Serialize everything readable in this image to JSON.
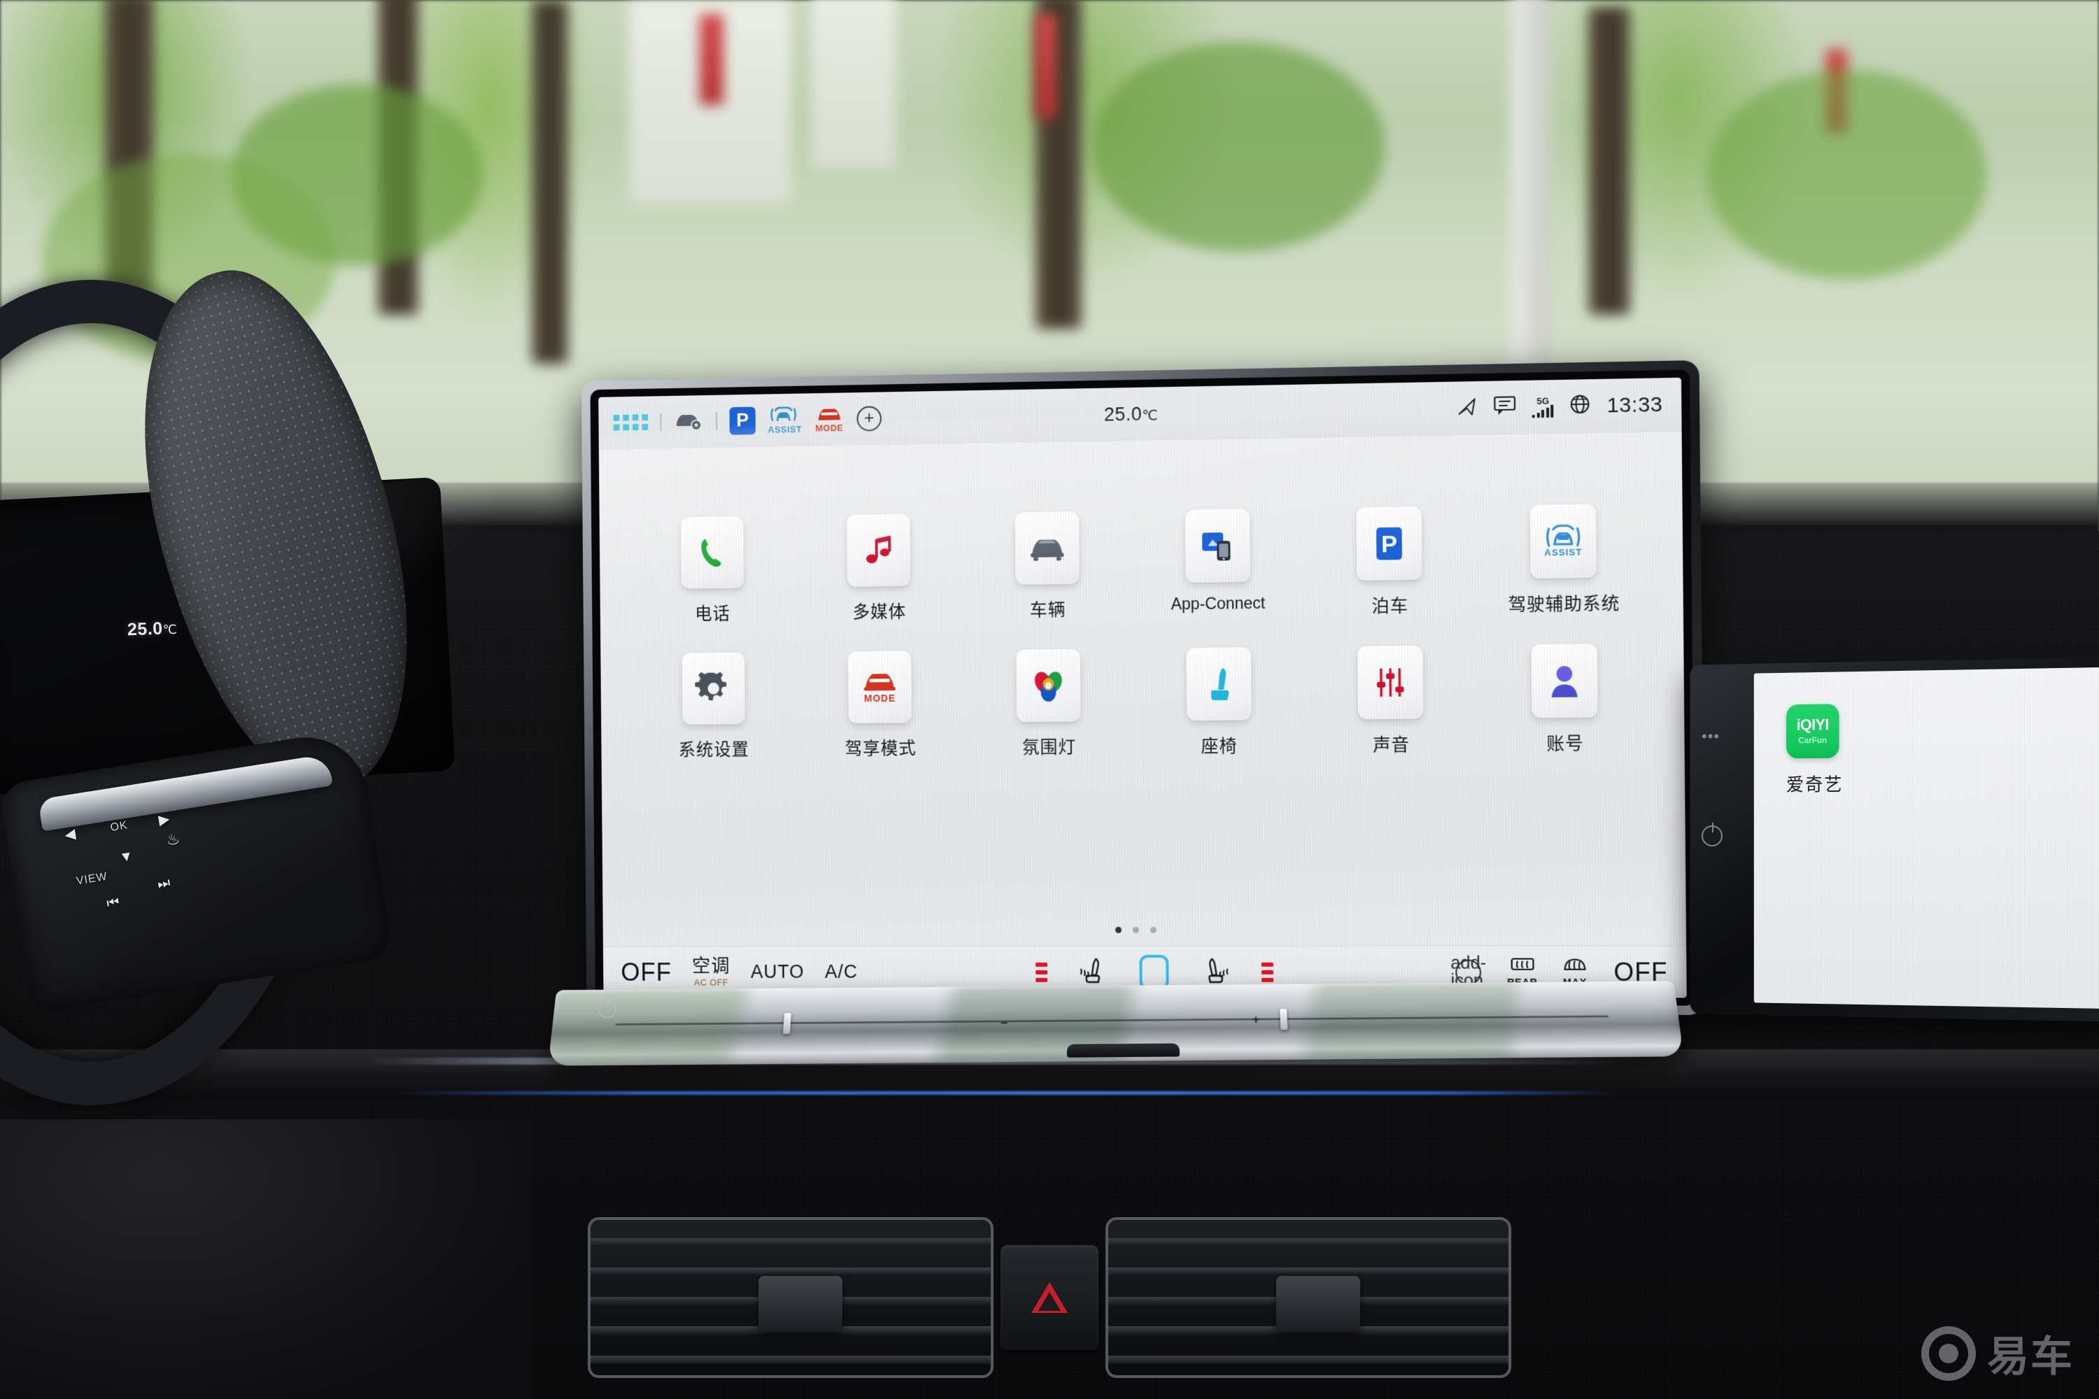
{
  "scene": {
    "description": "car-interior-dashboard",
    "watermark": {
      "text": "易车",
      "icon": "yiche-logo-icon"
    }
  },
  "cluster": {
    "temperature": "25.0",
    "unit": "℃"
  },
  "steering_wheel": {
    "buttons": [
      {
        "name": "view-button",
        "label": "VIEW"
      },
      {
        "name": "ok-button",
        "label": "OK"
      },
      {
        "name": "left-arrow-button",
        "label": "◀"
      },
      {
        "name": "right-arrow-button",
        "label": "▶"
      },
      {
        "name": "down-arrow-button",
        "label": "▼"
      },
      {
        "name": "previous-track-button",
        "label": "⏮"
      },
      {
        "name": "next-track-button",
        "label": "⏭"
      },
      {
        "name": "heated-wheel-button",
        "label": "♨"
      }
    ]
  },
  "head_unit": {
    "status_bar": {
      "left_icons": [
        {
          "name": "app-grid-icon",
          "label": "apps"
        },
        {
          "name": "vehicle-settings-icon",
          "label": "car-gear"
        },
        {
          "name": "parking-brake-icon",
          "label": "P"
        },
        {
          "name": "driver-assist-icon",
          "label": "ASSIST"
        },
        {
          "name": "drive-mode-icon",
          "label": "MODE"
        },
        {
          "name": "add-shortcut-icon",
          "label": "+"
        }
      ],
      "temperature": "25.0",
      "temperature_unit": "℃",
      "right_icons": [
        {
          "name": "navigation-arrow-icon",
          "label": "navigation"
        },
        {
          "name": "message-icon",
          "label": "messages"
        },
        {
          "name": "network-signal-icon",
          "label": "5G"
        },
        {
          "name": "globe-icon",
          "label": "browser"
        }
      ],
      "time": "13:33"
    },
    "apps": [
      {
        "label": "电话",
        "icon": "phone-icon",
        "color": "#1aa832"
      },
      {
        "label": "多媒体",
        "icon": "music-note-icon",
        "color": "#cc1230"
      },
      {
        "label": "车辆",
        "icon": "car-front-icon",
        "color": "#5a6470"
      },
      {
        "label": "App-Connect",
        "icon": "app-connect-icon",
        "color": "#1d62d8"
      },
      {
        "label": "泊车",
        "icon": "parking-p-icon",
        "color": "#1d62d8"
      },
      {
        "label": "驾驶辅助系统",
        "icon": "assist-car-icon",
        "color": "#2f8fd8"
      },
      {
        "label": "系统设置",
        "icon": "gear-icon",
        "color": "#4a525c"
      },
      {
        "label": "驾享模式",
        "icon": "drive-mode-icon",
        "color": "#d6341f"
      },
      {
        "label": "氛围灯",
        "icon": "ambient-light-icon",
        "color": "#2c8a4b"
      },
      {
        "label": "座椅",
        "icon": "seat-icon",
        "color": "#22b6d8"
      },
      {
        "label": "声音",
        "icon": "sound-mixer-icon",
        "color": "#cc1230"
      },
      {
        "label": "账号",
        "icon": "user-account-icon",
        "color": "#4b4fd0"
      }
    ],
    "pager": {
      "total": 3,
      "active": 1
    },
    "climate_bar": {
      "left_off": "OFF",
      "ac_label": "空调",
      "ac_sub": "AC OFF",
      "auto": "AUTO",
      "ac": "A/C",
      "driver_seat_icon": "seat-heat-driver-icon",
      "passenger_seat_icon": "seat-heat-passenger-icon",
      "center_toggle_icon": "climate-sync-icon",
      "plus_icon": "add-icon",
      "rear_defrost": "REAR",
      "max_defrost": "MAX",
      "right_off": "OFF"
    },
    "lower_strip": {
      "minus": "−",
      "plus": "+"
    }
  },
  "passenger_display": {
    "app": {
      "label": "爱奇艺",
      "wordmark": "iQIYI",
      "subbrand": "CarFun",
      "icon": "iqiyi-icon"
    },
    "buttons": [
      {
        "name": "brightness-button",
        "label": "•••"
      },
      {
        "name": "power-button",
        "label": "power"
      }
    ]
  },
  "colors": {
    "accent_blue": "#1d62d8",
    "assist_blue": "#2f8fd8",
    "mode_red": "#d6341f",
    "heat_red": "#e0152a",
    "cyan": "#35bdf0",
    "iqiyi_green": "#16c95f"
  }
}
